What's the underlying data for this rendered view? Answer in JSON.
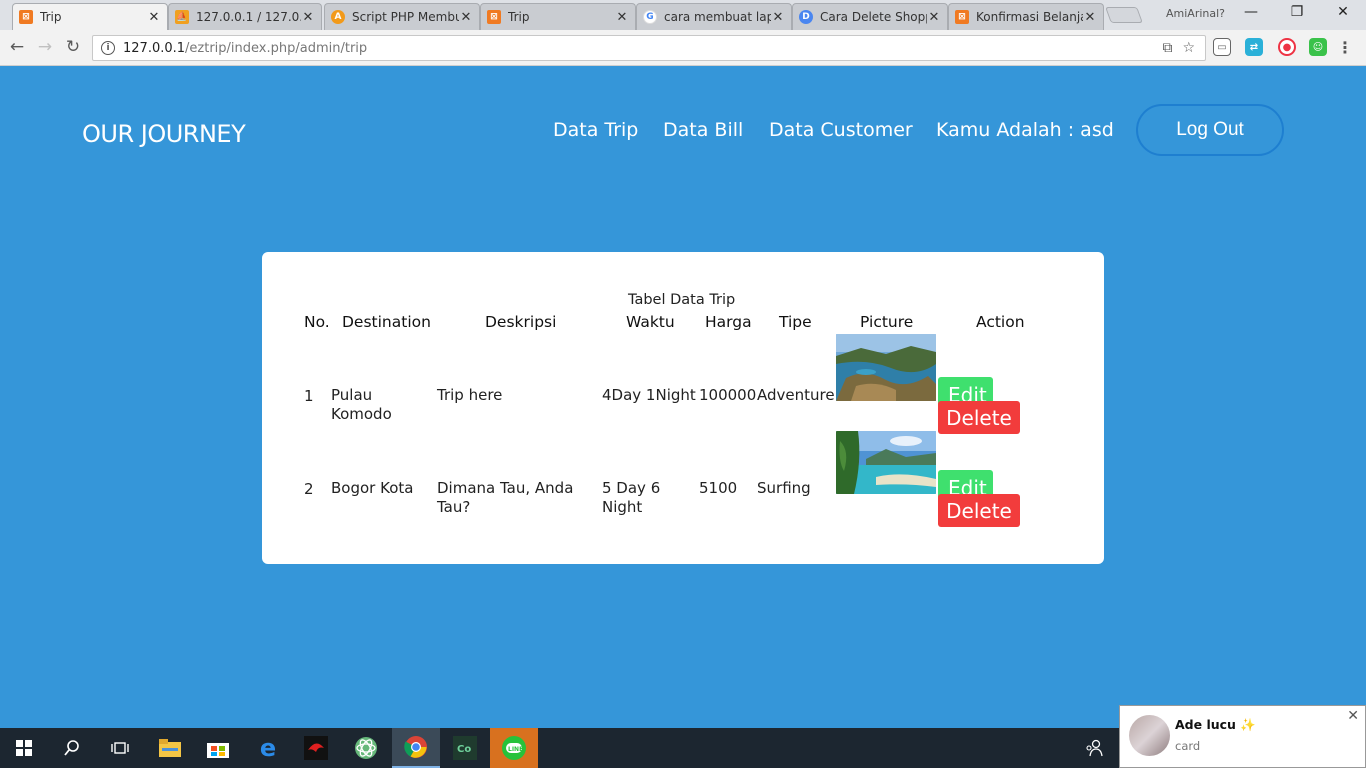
{
  "browser": {
    "tabs": [
      {
        "label": "Trip",
        "icon": "xampp-icon",
        "active": true
      },
      {
        "label": "127.0.0.1 / 127.0.0",
        "icon": "phpmyadmin-icon"
      },
      {
        "label": "Script PHP Membu",
        "icon": "a-icon"
      },
      {
        "label": "Trip",
        "icon": "xampp-icon"
      },
      {
        "label": "cara membuat lap",
        "icon": "google-icon"
      },
      {
        "label": "Cara Delete Shopp",
        "icon": "d-icon"
      },
      {
        "label": "Konfirmasi Belanja",
        "icon": "xampp-icon"
      }
    ],
    "close_glyph": "✕",
    "profile_name": "AmiArinal?",
    "url_host": "127.0.0.1",
    "url_path": "/eztrip/index.php/admin/trip"
  },
  "site": {
    "brand": "OUR JOURNEY",
    "nav": [
      "Data Trip",
      "Data Bill",
      "Data Customer"
    ],
    "user_label": "Kamu Adalah : asd",
    "logout_label": "Log Out"
  },
  "table": {
    "caption": "Tabel Data Trip",
    "headers": [
      "No.",
      "Destination",
      "Deskripsi",
      "Waktu",
      "Harga",
      "Tipe",
      "Picture",
      "Action"
    ],
    "rows": [
      {
        "no": "1",
        "destination": "Pulau Komodo",
        "deskripsi": "Trip here",
        "waktu": "4Day 1Night",
        "harga": "100000",
        "tipe": "Adventure",
        "picture": "komodo island landscape",
        "edit": "Edit",
        "delete": "Delete"
      },
      {
        "no": "2",
        "destination": "Bogor Kota",
        "deskripsi": "Dimana Tau, Anda Tau?",
        "waktu": "5 Day 6 Night",
        "harga": "5100",
        "tipe": "Surfing",
        "picture": "tropical beach landscape",
        "edit": "Edit",
        "delete": "Delete"
      }
    ]
  },
  "notification": {
    "name": "Ade lucu",
    "sparkle": "✨",
    "message": "card",
    "close_glyph": "✕"
  },
  "colors": {
    "page_bg": "#3596d9",
    "edit_button": "#3fe06e",
    "delete_button": "#f23c3c",
    "logout_border": "#1e7fd0"
  }
}
